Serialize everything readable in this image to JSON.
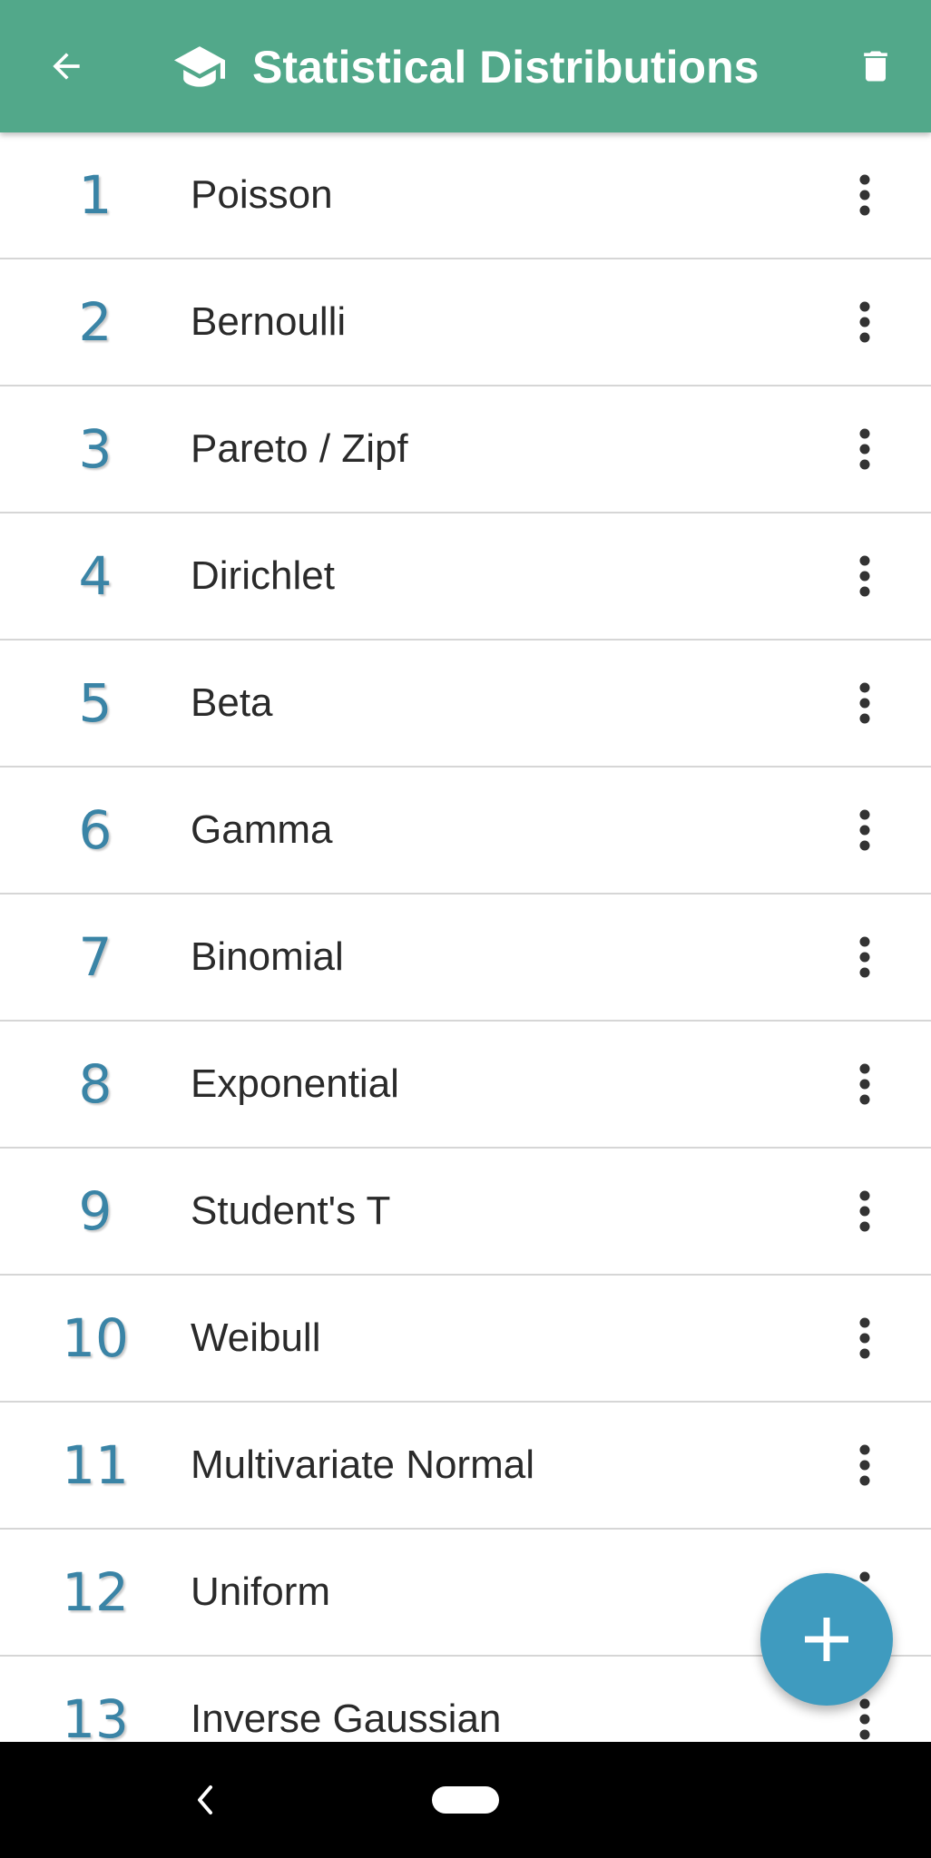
{
  "header": {
    "title": "Statistical Distributions",
    "back_icon": "arrow-left-icon",
    "title_icon": "graduation-cap-icon",
    "delete_icon": "trash-icon",
    "background_color": "#52a88a"
  },
  "list": {
    "rows": [
      {
        "number": "1",
        "name": "Poisson"
      },
      {
        "number": "2",
        "name": "Bernoulli"
      },
      {
        "number": "3",
        "name": "Pareto / Zipf"
      },
      {
        "number": "4",
        "name": "Dirichlet"
      },
      {
        "number": "5",
        "name": "Beta"
      },
      {
        "number": "6",
        "name": "Gamma"
      },
      {
        "number": "7",
        "name": "Binomial"
      },
      {
        "number": "8",
        "name": "Exponential"
      },
      {
        "number": "9",
        "name": "Student's T"
      },
      {
        "number": "10",
        "name": "Weibull"
      },
      {
        "number": "11",
        "name": "Multivariate Normal"
      },
      {
        "number": "12",
        "name": "Uniform"
      },
      {
        "number": "13",
        "name": "Inverse Gaussian"
      }
    ],
    "row_menu_icon": "more-vertical-icon",
    "number_color": "#3a84a6"
  },
  "fab": {
    "icon": "plus-icon",
    "color": "#3f9bbf"
  },
  "system_nav": {
    "back_icon": "chevron-left-icon",
    "home_icon": "home-pill-icon"
  }
}
